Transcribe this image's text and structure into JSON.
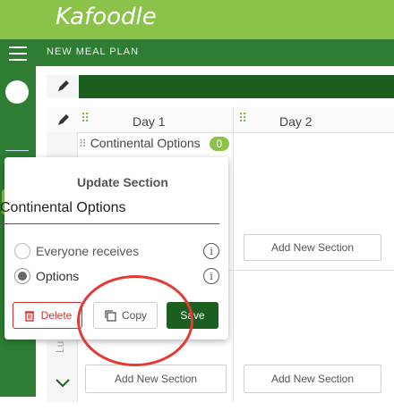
{
  "app": {
    "logo": "Kafoodle",
    "nav_title": "NEW MEAL PLAN"
  },
  "colors": {
    "brand_light": "#8bc34a",
    "brand_dark": "#2e7d32",
    "save": "#1b5e20",
    "delete": "#d32f2f",
    "annotation": "#e53935"
  },
  "grid": {
    "day1": "Day 1",
    "day2": "Day 2",
    "section_name": "Continental Options",
    "section_count": "0",
    "add_section": "Add New Section",
    "row_label": "Lu"
  },
  "popup": {
    "title": "Update Section",
    "input_value": "Continental Options",
    "option_everyone": "Everyone receives",
    "option_options": "Options",
    "selected_option": "Options",
    "delete_label": "Delete",
    "copy_label": "Copy",
    "save_label": "Save"
  },
  "icons": [
    "menu-icon",
    "pencil-icon",
    "drag-handle-icon",
    "info-icon",
    "trash-icon",
    "copy-icon",
    "chevron-down-icon"
  ]
}
